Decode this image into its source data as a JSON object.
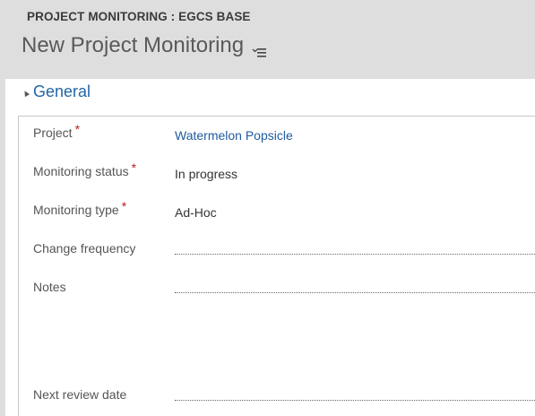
{
  "header": {
    "entity_title": "PROJECT MONITORING : EGCS BASE",
    "record_title": "New Project Monitoring"
  },
  "section": {
    "title": "General"
  },
  "fields": {
    "project": {
      "label": "Project",
      "required_mark": "*",
      "value": "Watermelon Popsicle"
    },
    "monitoring_status": {
      "label": "Monitoring status",
      "required_mark": "*",
      "value": "In progress"
    },
    "monitoring_type": {
      "label": "Monitoring type",
      "required_mark": "*",
      "value": "Ad-Hoc"
    },
    "change_frequency": {
      "label": "Change frequency",
      "value": ""
    },
    "notes": {
      "label": "Notes",
      "value": ""
    },
    "next_review_date": {
      "label": "Next review date",
      "value": ""
    }
  },
  "colors": {
    "header_bg": "#dedede",
    "section_title": "#2266a8",
    "link": "#1f5a9e",
    "required": "#b82020"
  },
  "icons": {
    "form_menu": "form-menu-icon",
    "collapse": "collapse-arrow-icon"
  }
}
